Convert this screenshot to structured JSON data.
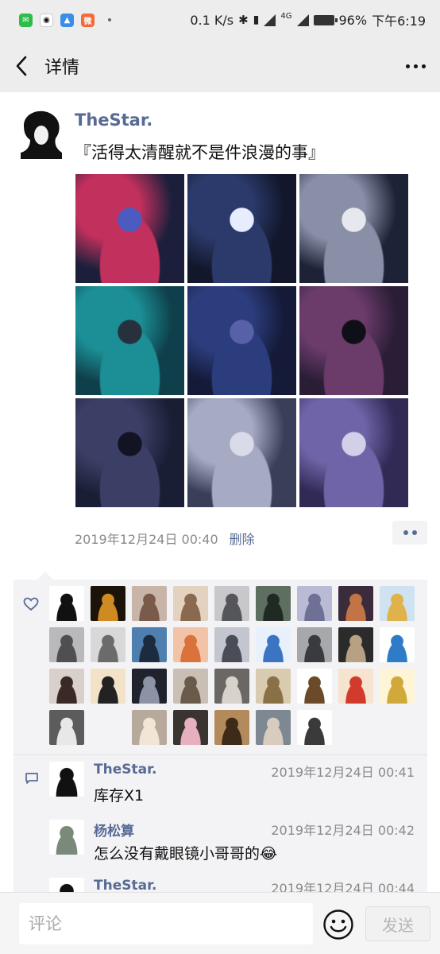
{
  "status_bar": {
    "network_speed": "0.1 K/s",
    "network_type": "4G",
    "battery": "96%",
    "time": "下午6:19",
    "icons": [
      "wechat-icon",
      "qq-icon",
      "app-icon",
      "weibo-icon",
      "bluetooth-icon",
      "vibrate-icon",
      "signal-icon",
      "battery-icon"
    ]
  },
  "nav": {
    "title": "详情"
  },
  "post": {
    "author": "TheStar.",
    "text": "『活得太清醒就不是件浪漫的事』",
    "photos": [
      {
        "name": "photo-1",
        "colors": [
          "#1b1f3b",
          "#c2305d",
          "#4b5bc0"
        ]
      },
      {
        "name": "photo-2",
        "colors": [
          "#12172b",
          "#2b3a6b",
          "#e8ecff"
        ]
      },
      {
        "name": "photo-3",
        "colors": [
          "#1d2236",
          "#8a8fa8",
          "#e7e7ee"
        ]
      },
      {
        "name": "photo-4",
        "colors": [
          "#0f3f4a",
          "#1b8f95",
          "#27303d"
        ]
      },
      {
        "name": "photo-5",
        "colors": [
          "#141a38",
          "#2c3d7e",
          "#5661a8"
        ]
      },
      {
        "name": "photo-6",
        "colors": [
          "#2a1e36",
          "#6b3b6a",
          "#0f0f18"
        ]
      },
      {
        "name": "photo-7",
        "colors": [
          "#1a1e35",
          "#3b3f66",
          "#121424"
        ]
      },
      {
        "name": "photo-8",
        "colors": [
          "#3a3e58",
          "#a6aac2",
          "#d9dbe8"
        ]
      },
      {
        "name": "photo-9",
        "colors": [
          "#302a55",
          "#7064a8",
          "#d2cfe8"
        ]
      }
    ],
    "date": "2019年12月24日 00:40",
    "delete_label": "删除"
  },
  "likes": {
    "avatars": [
      {
        "name": "liker-avatar",
        "bg": "#ffffff",
        "fg": "#111111"
      },
      {
        "name": "liker-avatar",
        "bg": "#1b1208",
        "fg": "#d08a22"
      },
      {
        "name": "liker-avatar",
        "bg": "#c9b4a8",
        "fg": "#7a5a4a"
      },
      {
        "name": "liker-avatar",
        "bg": "#e4d2c0",
        "fg": "#8a6a4e"
      },
      {
        "name": "liker-avatar",
        "bg": "#c8c8cc",
        "fg": "#55555c"
      },
      {
        "name": "liker-avatar",
        "bg": "#5e6f62",
        "fg": "#1f2a22"
      },
      {
        "name": "liker-avatar",
        "bg": "#b9bbd4",
        "fg": "#6e7096"
      },
      {
        "name": "liker-avatar",
        "bg": "#3a2c3a",
        "fg": "#c27447"
      },
      {
        "name": "liker-avatar",
        "bg": "#cfe2f2",
        "fg": "#e0b24a"
      },
      {
        "name": "liker-avatar",
        "bg": "#b9b9bb",
        "fg": "#4f4f52"
      },
      {
        "name": "liker-avatar",
        "bg": "#d8d8d8",
        "fg": "#6b6b6b"
      },
      {
        "name": "liker-avatar",
        "bg": "#4f7fae",
        "fg": "#1c2c3e"
      },
      {
        "name": "liker-avatar",
        "bg": "#f3c3a8",
        "fg": "#d9733b"
      },
      {
        "name": "liker-avatar",
        "bg": "#c3c5cf",
        "fg": "#4a4c58"
      },
      {
        "name": "liker-avatar",
        "bg": "#e8f1fb",
        "fg": "#3a74c2"
      },
      {
        "name": "liker-avatar",
        "bg": "#a7a8ab",
        "fg": "#3a3b3e"
      },
      {
        "name": "liker-avatar",
        "bg": "#2b2b2b",
        "fg": "#b8a082"
      },
      {
        "name": "liker-avatar",
        "bg": "#ffffff",
        "fg": "#2e7cc8"
      },
      {
        "name": "liker-avatar",
        "bg": "#d9cfcb",
        "fg": "#3a2a26"
      },
      {
        "name": "liker-avatar",
        "bg": "#f2e2c8",
        "fg": "#222222"
      },
      {
        "name": "liker-avatar",
        "bg": "#20232e",
        "fg": "#8d93a6"
      },
      {
        "name": "liker-avatar",
        "bg": "#c9bfb5",
        "fg": "#6a5a4a"
      },
      {
        "name": "liker-avatar",
        "bg": "#6b6764",
        "fg": "#d8d2cc"
      },
      {
        "name": "liker-avatar",
        "bg": "#d8cbb0",
        "fg": "#8a7047"
      },
      {
        "name": "liker-avatar",
        "bg": "#ffffff",
        "fg": "#6b4a2a"
      },
      {
        "name": "liker-avatar",
        "bg": "#f6e3d0",
        "fg": "#d23b2b"
      },
      {
        "name": "liker-avatar",
        "bg": "#fff4d6",
        "fg": "#d1a93a"
      },
      {
        "name": "liker-avatar",
        "bg": "#5c5c5c",
        "fg": "#e8e8e8"
      },
      {
        "name": "liker-avatar",
        "bg": "#f3f3f5",
        "fg": "#f3f3f5"
      },
      {
        "name": "liker-avatar",
        "bg": "#b7aa9c",
        "fg": "#f2e5d6"
      },
      {
        "name": "liker-avatar",
        "bg": "#3a3430",
        "fg": "#e6b0c0"
      },
      {
        "name": "liker-avatar",
        "bg": "#b38a5b",
        "fg": "#3e2a18"
      },
      {
        "name": "liker-avatar",
        "bg": "#7e8892",
        "fg": "#d9cbbd"
      },
      {
        "name": "liker-avatar",
        "bg": "#ffffff",
        "fg": "#3a3a3a"
      }
    ]
  },
  "comments": [
    {
      "name": "TheStar.",
      "time": "2019年12月24日 00:41",
      "text": "库存X1",
      "avatar_bg": "#ffffff",
      "avatar_fg": "#111111"
    },
    {
      "name": "杨松算",
      "time": "2019年12月24日 00:42",
      "text": "怎么没有戴眼镜小哥哥的😂",
      "avatar_bg": "#ffffff",
      "avatar_fg": "#7a8a7a"
    },
    {
      "name": "TheStar.",
      "time": "2019年12月24日 00:44",
      "text": "",
      "avatar_bg": "#ffffff",
      "avatar_fg": "#111111"
    }
  ],
  "input": {
    "placeholder": "评论",
    "send_label": "发送"
  },
  "colors": {
    "link": "#576b95",
    "panel": "#f3f3f5",
    "bar": "#ededed"
  }
}
